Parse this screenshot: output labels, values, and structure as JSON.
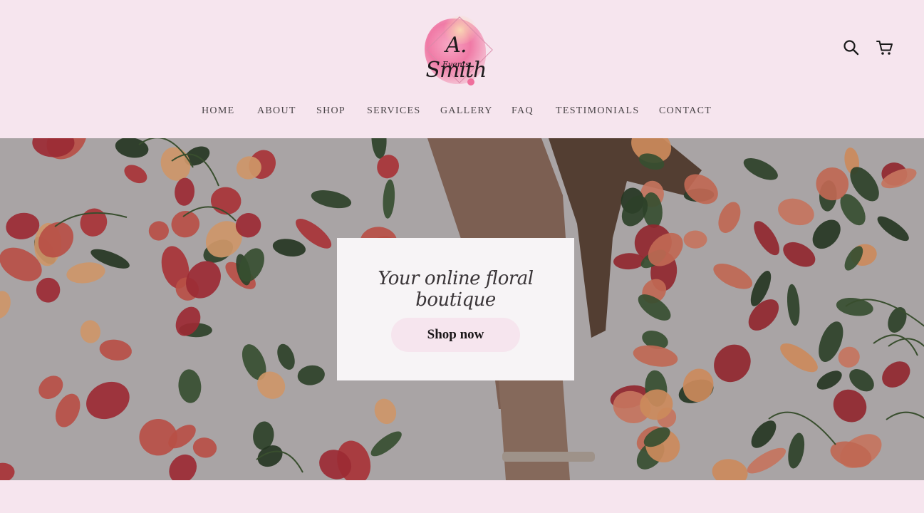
{
  "brand": {
    "logo_name": "A. Smith",
    "logo_sub": "Events",
    "accent_color": "#f6e5ee",
    "logo_pink": "#ef6f9c"
  },
  "header": {
    "search_icon": "search-icon",
    "cart_icon": "cart-icon"
  },
  "nav": {
    "items": [
      {
        "label": "HOME"
      },
      {
        "label": "ABOUT"
      },
      {
        "label": "SHOP"
      },
      {
        "label": "SERVICES"
      },
      {
        "label": "GALLERY"
      },
      {
        "label": "FAQ"
      },
      {
        "label": "TESTIMONIALS"
      },
      {
        "label": "CONTACT"
      }
    ]
  },
  "hero": {
    "tagline": "Your online floral boutique",
    "cta_label": "Shop now"
  }
}
